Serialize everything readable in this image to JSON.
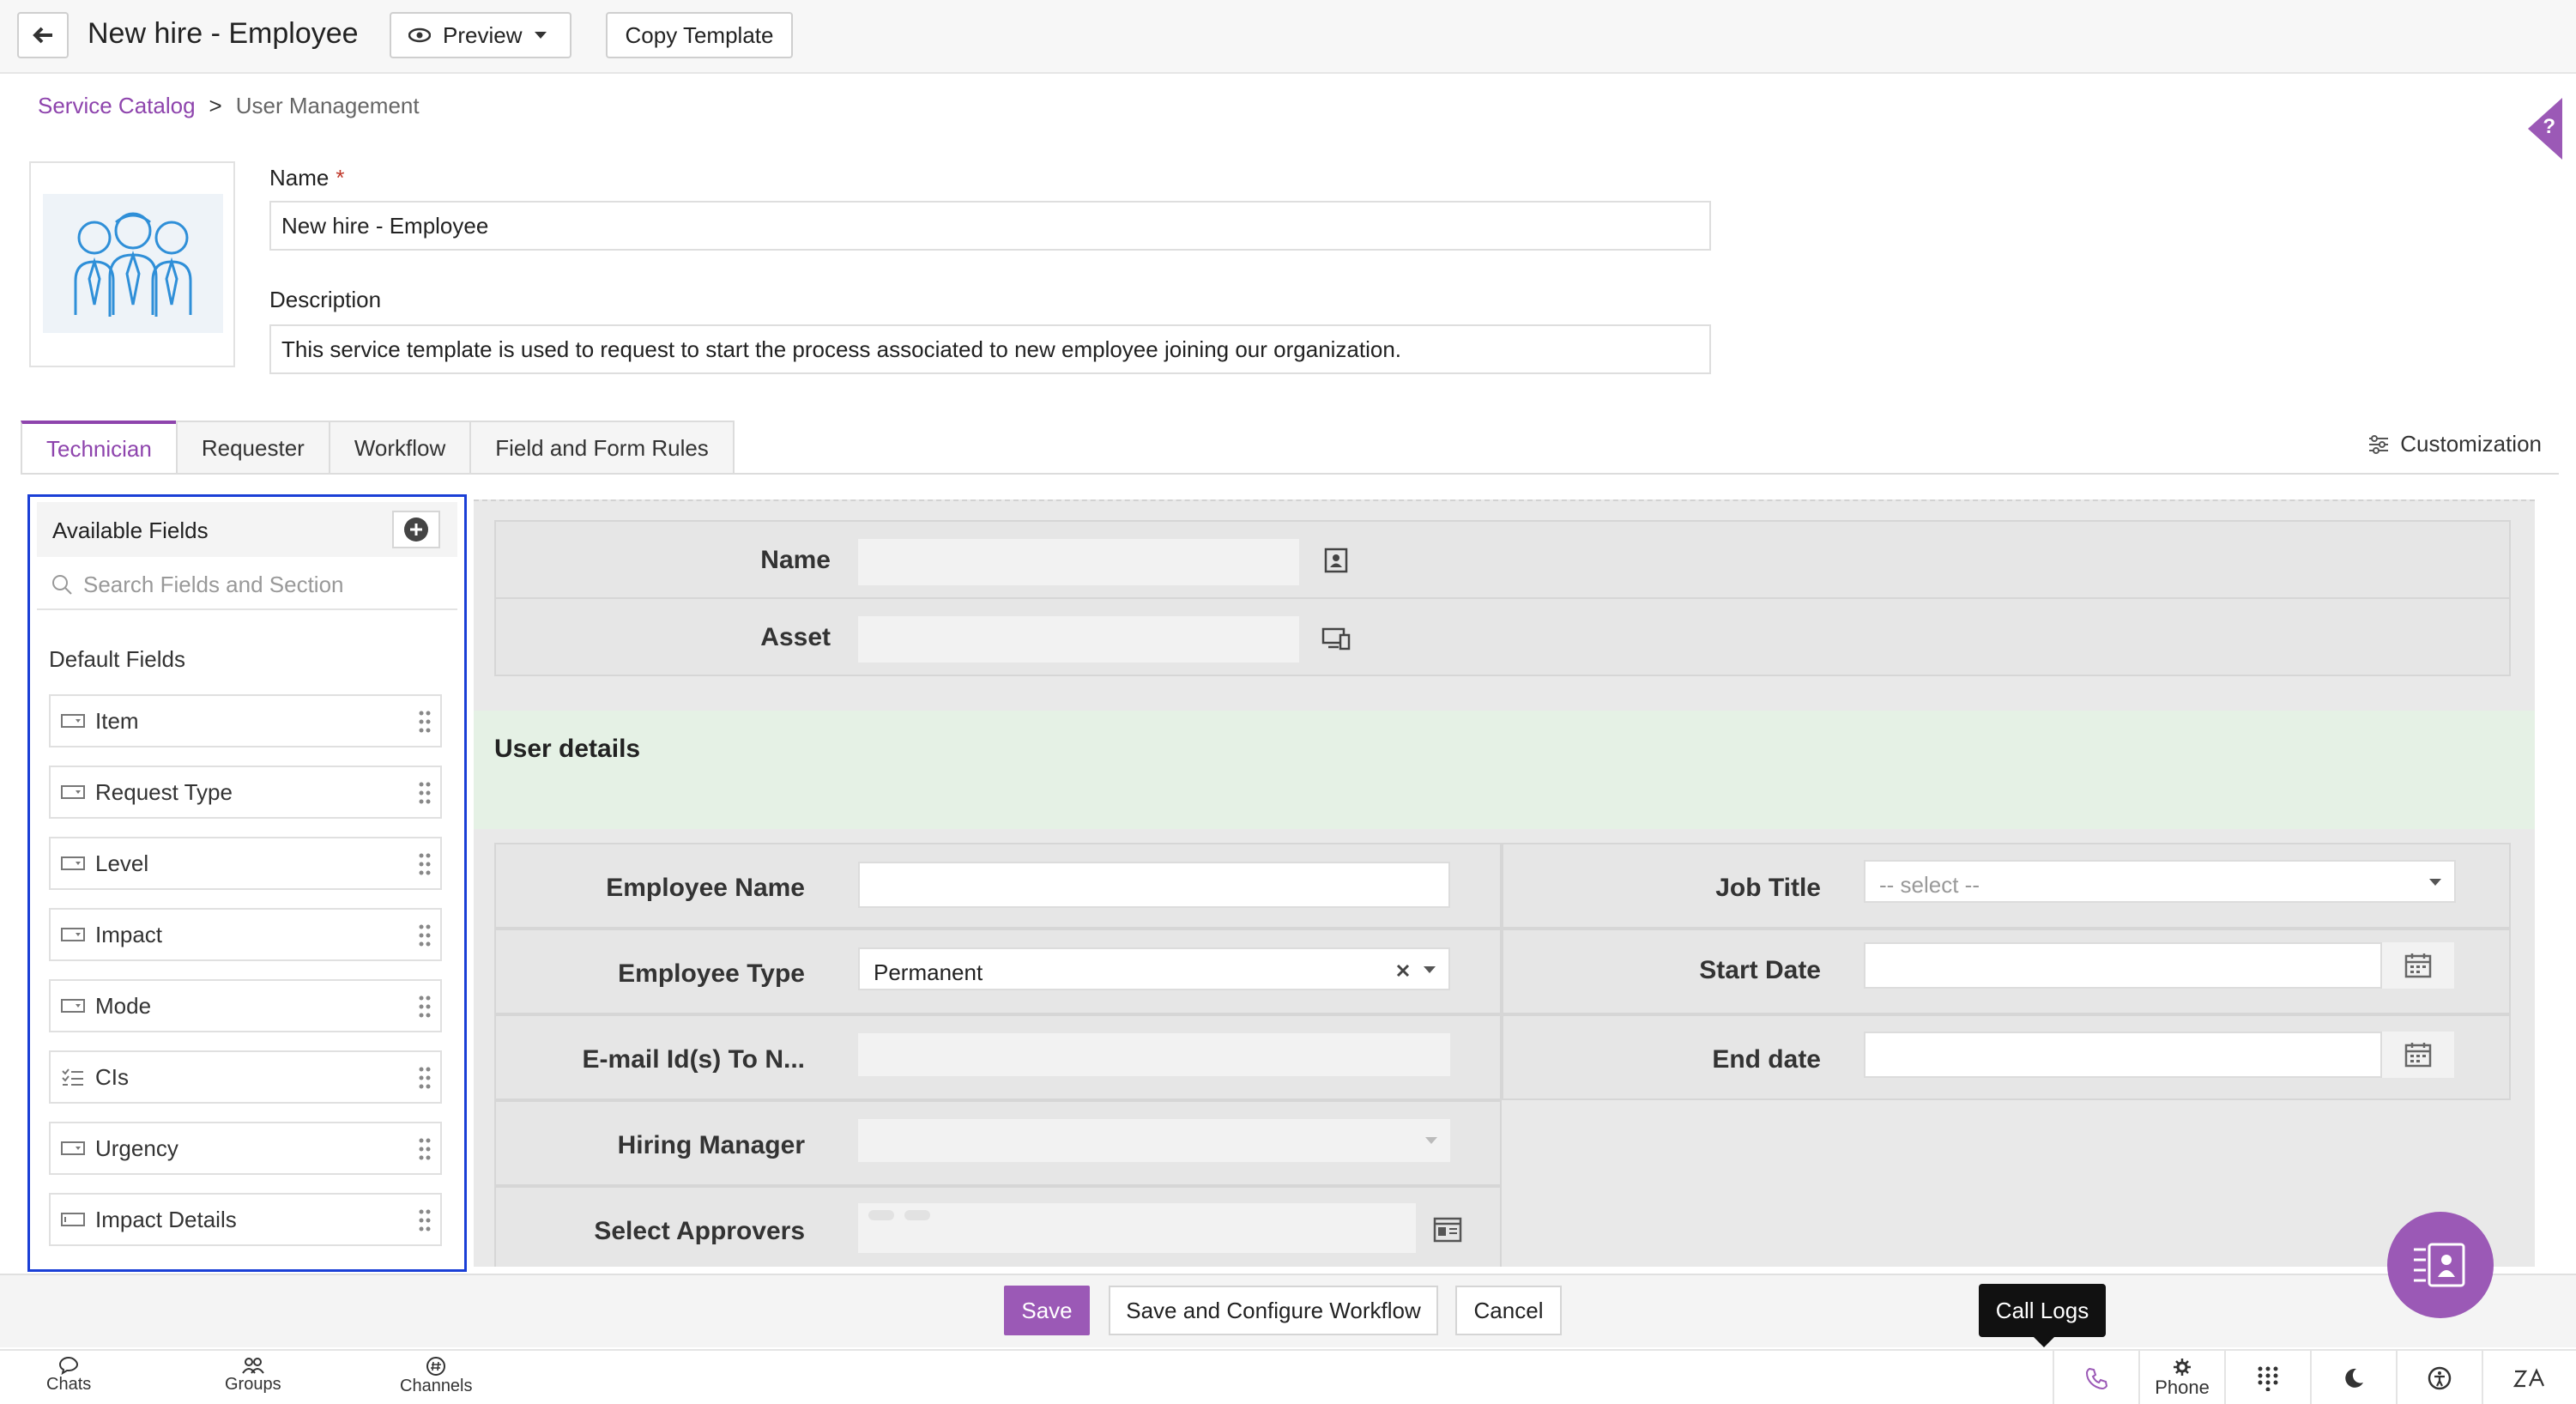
{
  "header": {
    "title": "New hire - Employee",
    "preview_label": "Preview",
    "copy_template_label": "Copy Template"
  },
  "breadcrumb": {
    "link": "Service Catalog",
    "separator": ">",
    "current": "User Management"
  },
  "help_tab": "?",
  "form": {
    "name_label": "Name",
    "required_mark": "*",
    "name_value": "New hire - Employee",
    "description_label": "Description",
    "description_value": "This service template is used to request to start the process associated to new employee joining our organization."
  },
  "tabs": [
    {
      "label": "Technician",
      "active": true
    },
    {
      "label": "Requester",
      "active": false
    },
    {
      "label": "Workflow",
      "active": false
    },
    {
      "label": "Field and Form Rules",
      "active": false
    }
  ],
  "customization_label": "Customization",
  "available_fields": {
    "title": "Available Fields",
    "search_placeholder": "Search Fields and Section",
    "section_label": "Default Fields",
    "items": [
      {
        "label": "Item",
        "icon": "dropdown-field-icon"
      },
      {
        "label": "Request Type",
        "icon": "dropdown-field-icon"
      },
      {
        "label": "Level",
        "icon": "dropdown-field-icon"
      },
      {
        "label": "Impact",
        "icon": "dropdown-field-icon"
      },
      {
        "label": "Mode",
        "icon": "dropdown-field-icon"
      },
      {
        "label": "CIs",
        "icon": "checklist-field-icon"
      },
      {
        "label": "Urgency",
        "icon": "dropdown-field-icon"
      },
      {
        "label": "Impact Details",
        "icon": "textbox-field-icon"
      }
    ]
  },
  "canvas": {
    "top_fields": [
      {
        "label": "Name",
        "icon": "contact-card-icon"
      },
      {
        "label": "Asset",
        "icon": "devices-icon"
      }
    ],
    "section_title": "User details",
    "left_fields": [
      {
        "label": "Employee Name",
        "value": ""
      },
      {
        "label": "Employee Type",
        "value": "Permanent"
      },
      {
        "label": "E-mail Id(s) To N...",
        "value": ""
      },
      {
        "label": "Hiring Manager",
        "value": ""
      },
      {
        "label": "Select Approvers",
        "value": ""
      }
    ],
    "right_fields": [
      {
        "label": "Job Title",
        "value": "-- select --"
      },
      {
        "label": "Start Date",
        "value": ""
      },
      {
        "label": "End date",
        "value": ""
      }
    ]
  },
  "actions": {
    "save": "Save",
    "save_configure": "Save and Configure Workflow",
    "cancel": "Cancel"
  },
  "tooltip": "Call Logs",
  "statusbar": {
    "chats": "Chats",
    "groups": "Groups",
    "channels": "Channels",
    "phone": "Phone"
  },
  "colors": {
    "accent": "#9b59b6",
    "highlight_border": "#1a3fd6",
    "section_band": "#e5f1e5"
  }
}
